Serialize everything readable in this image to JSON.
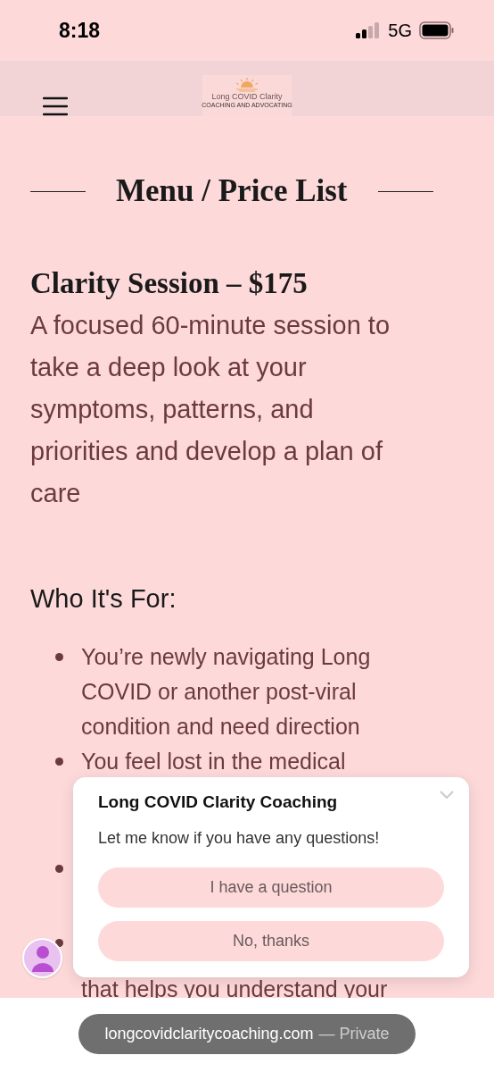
{
  "status_bar": {
    "time": "8:18",
    "network": "5G"
  },
  "header": {
    "logo_title": "Long COVID Clarity",
    "logo_subtitle": "COACHING AND ADVOCATING"
  },
  "page_title": "Menu / Price List",
  "service": {
    "title": "Clarity Session – $175",
    "description": "A focused 60-minute session to take a deep look at your symptoms, patterns, and priorities and develop a plan of care"
  },
  "audience": {
    "heading": "Who It's For:",
    "items": [
      {
        "text": "You’re newly navigating Long COVID or another post-viral condition and need direction"
      },
      {
        "text": "You feel lost in the medical"
      },
      {
        "kind": "covered"
      },
      {
        "text": "that helps you understand your"
      }
    ]
  },
  "chat_popup": {
    "title": "Long COVID Clarity Coaching",
    "message": "Let me know if you have any questions!",
    "buttons": [
      "I have a question",
      "No, thanks"
    ]
  },
  "browser": {
    "domain": "longcovidclaritycoaching.com",
    "suffix": "— Private"
  }
}
